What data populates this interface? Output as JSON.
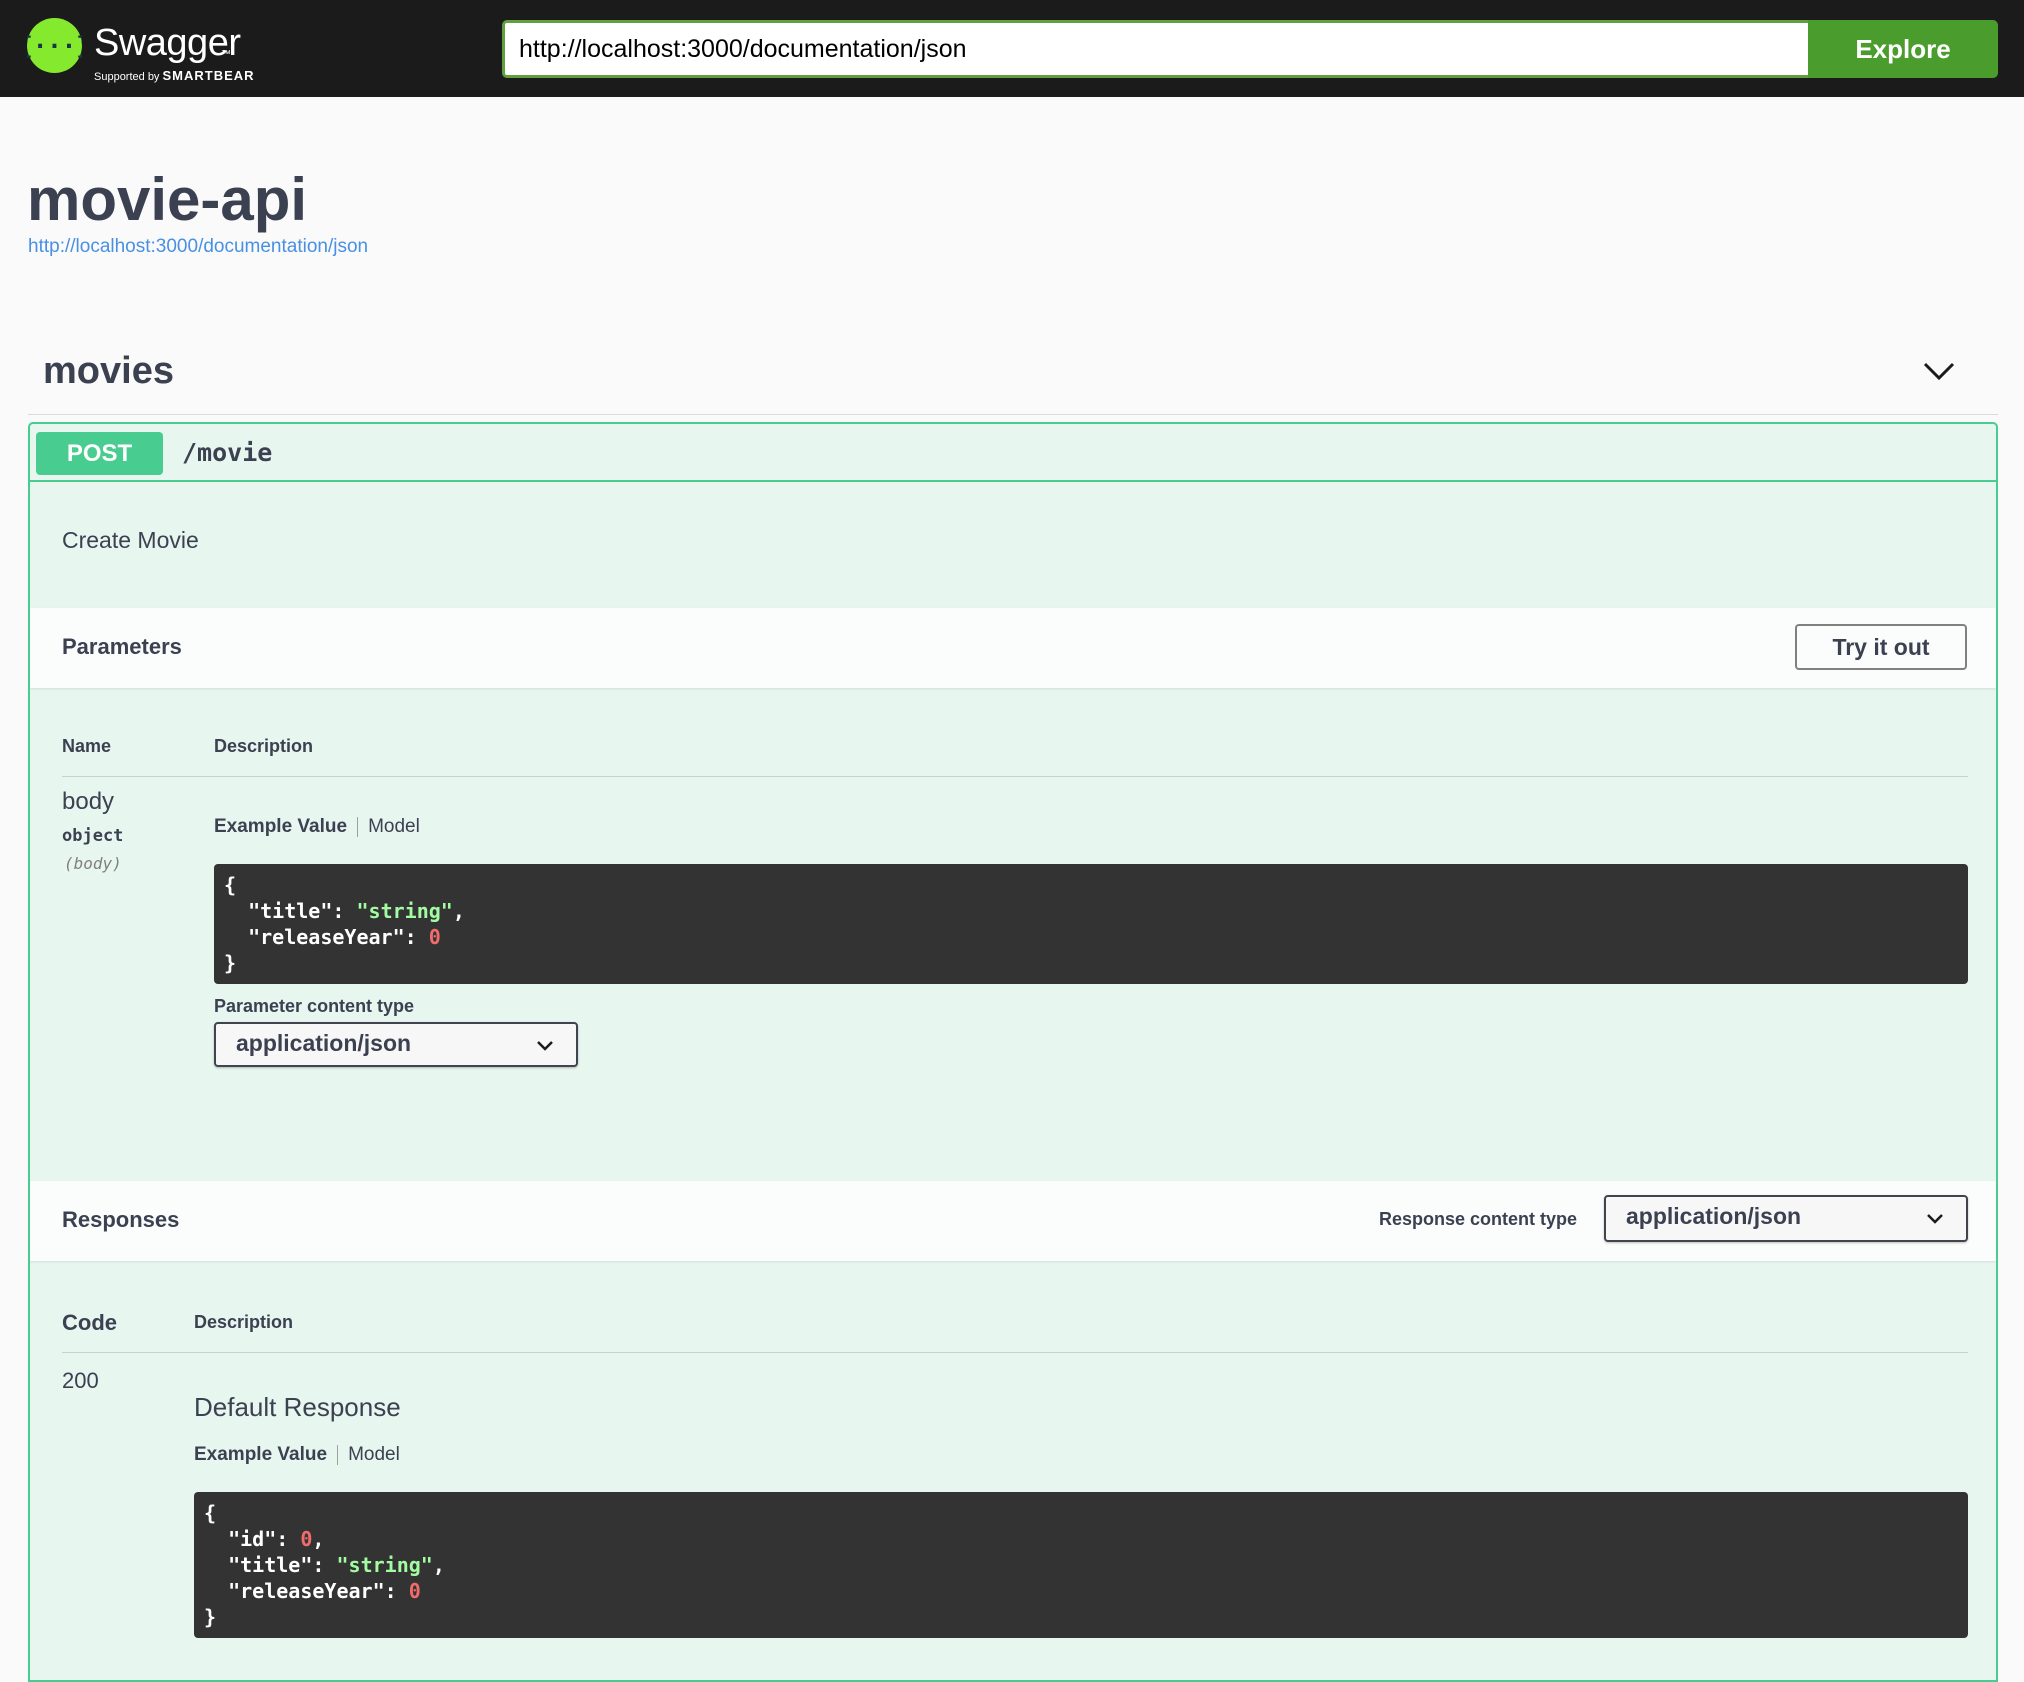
{
  "header": {
    "logo_text": "Swagger",
    "logo_tm": "™",
    "logo_supported": "Supported by",
    "logo_brand": "SMARTBEAR",
    "url_value": "http://localhost:3000/documentation/json",
    "explore_label": "Explore"
  },
  "info": {
    "title": "movie-api",
    "spec_link": "http://localhost:3000/documentation/json"
  },
  "tag": {
    "name": "movies"
  },
  "operation": {
    "method": "POST",
    "path": "/movie",
    "summary": "Create Movie",
    "parameters": {
      "title": "Parameters",
      "try_label": "Try it out",
      "col_name": "Name",
      "col_description": "Description",
      "param_name": "body",
      "param_type": "object",
      "param_in": "(body)",
      "tab_example": "Example Value",
      "tab_model": "Model",
      "example": {
        "open": "{",
        "k1": "\"title\"",
        "v1": "\"string\"",
        "k2": "\"releaseYear\"",
        "v2": "0",
        "close": "}"
      },
      "content_type_label": "Parameter content type",
      "content_type_value": "application/json"
    },
    "responses": {
      "title": "Responses",
      "content_type_label": "Response content type",
      "content_type_value": "application/json",
      "col_code": "Code",
      "col_description": "Description",
      "code": "200",
      "description": "Default Response",
      "tab_example": "Example Value",
      "tab_model": "Model",
      "example": {
        "open": "{",
        "k1": "\"id\"",
        "v1": "0",
        "k2": "\"title\"",
        "v2": "\"string\"",
        "k3": "\"releaseYear\"",
        "v3": "0",
        "close": "}"
      }
    }
  },
  "colors": {
    "topbar": "#1b1b1b",
    "logo_green": "#85ea2d",
    "explore_green": "#4a9d2c",
    "post_green": "#49cc90",
    "opblock_bg": "#e8f6f0",
    "code_bg": "#333333",
    "string_green": "#a2fca2",
    "number_red": "#f06b6b",
    "link_blue": "#4990e2"
  },
  "icons": {
    "logo": "swagger-braces-icon",
    "collapse": "chevron-down-icon",
    "select": "chevron-down-icon"
  }
}
